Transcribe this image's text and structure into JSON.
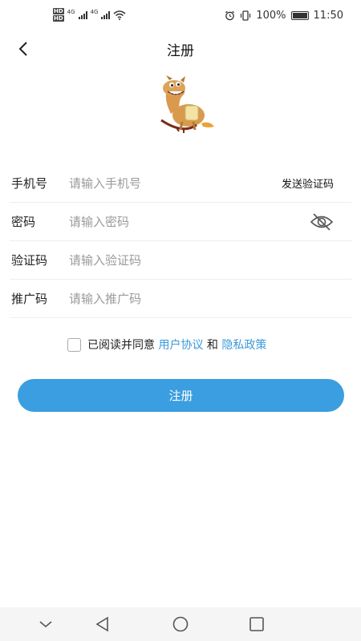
{
  "status_bar": {
    "hd1": "HD",
    "hd2": "HD",
    "net1": "4G",
    "net2": "4G",
    "battery": "100%",
    "time": "11:50"
  },
  "nav": {
    "title": "注册"
  },
  "form": {
    "phone": {
      "label": "手机号",
      "placeholder": "请输入手机号",
      "send_code": "发送验证码"
    },
    "password": {
      "label": "密码",
      "placeholder": "请输入密码"
    },
    "code": {
      "label": "验证码",
      "placeholder": "请输入验证码"
    },
    "referral": {
      "label": "推广码",
      "placeholder": "请输入推广码"
    }
  },
  "agreement": {
    "prefix": "已阅读并同意",
    "user_agreement": "用户协议",
    "and": "和",
    "privacy_policy": "隐私政策"
  },
  "register_button": "注册",
  "colors": {
    "accent": "#3b9ee0",
    "link": "#3a9ad9"
  }
}
